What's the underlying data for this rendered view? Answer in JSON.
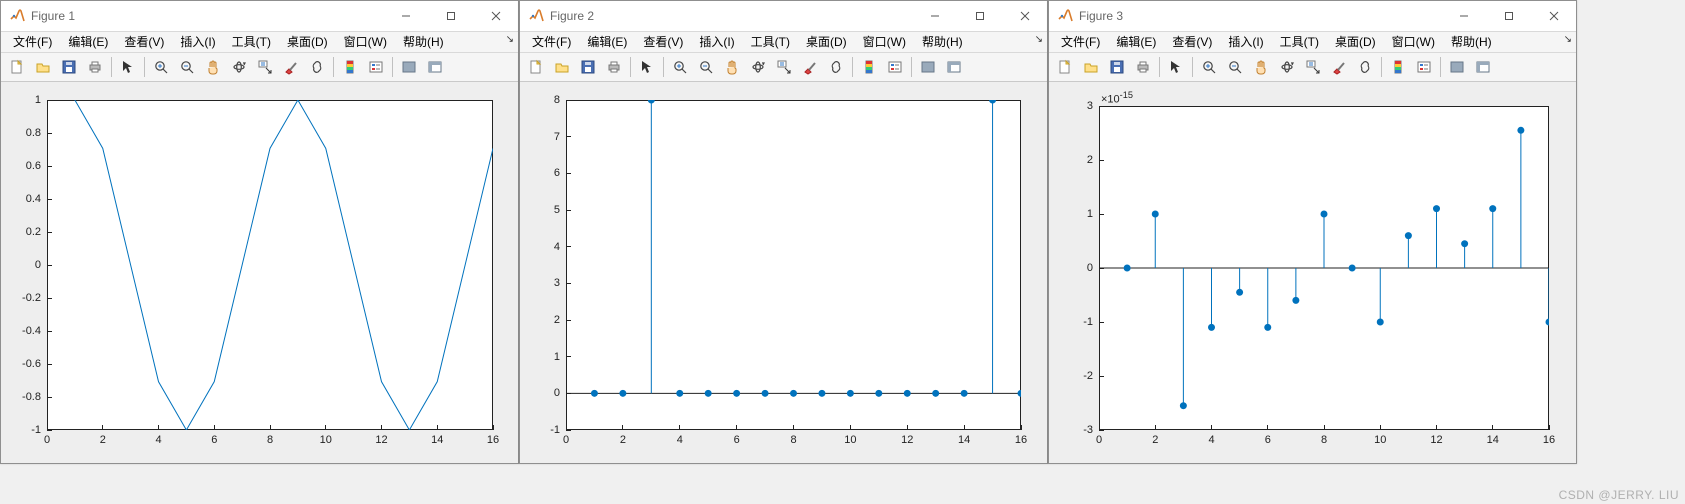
{
  "watermark": "CSDN @JERRY. LIU",
  "menus": [
    "文件(F)",
    "编辑(E)",
    "查看(V)",
    "插入(I)",
    "工具(T)",
    "桌面(D)",
    "窗口(W)",
    "帮助(H)"
  ],
  "toolbar_icons": [
    {
      "name": "new-figure-icon",
      "kind": "new"
    },
    {
      "name": "open-icon",
      "kind": "open"
    },
    {
      "name": "save-icon",
      "kind": "save"
    },
    {
      "name": "print-icon",
      "kind": "print"
    },
    {
      "sep": true
    },
    {
      "name": "edit-plot-icon",
      "kind": "arrow"
    },
    {
      "sep": true
    },
    {
      "name": "zoom-in-icon",
      "kind": "zoomin"
    },
    {
      "name": "zoom-out-icon",
      "kind": "zoomout"
    },
    {
      "name": "pan-icon",
      "kind": "hand"
    },
    {
      "name": "rotate-3d-icon",
      "kind": "rotate"
    },
    {
      "name": "data-cursor-icon",
      "kind": "datacursor"
    },
    {
      "name": "brush-icon",
      "kind": "brush"
    },
    {
      "name": "link-plot-icon",
      "kind": "link"
    },
    {
      "sep": true
    },
    {
      "name": "insert-colorbar-icon",
      "kind": "colorbar"
    },
    {
      "name": "insert-legend-icon",
      "kind": "legend"
    },
    {
      "sep": true
    },
    {
      "name": "hide-plot-tools-icon",
      "kind": "hidetools"
    },
    {
      "name": "show-plot-tools-icon",
      "kind": "showtools"
    }
  ],
  "windows": [
    {
      "title": "Figure 1"
    },
    {
      "title": "Figure 2"
    },
    {
      "title": "Figure 3"
    }
  ],
  "colors": {
    "line": "#0072BD",
    "marker": "#0072BD"
  },
  "chart_data": [
    {
      "type": "line",
      "x": [
        1,
        2,
        3,
        4,
        5,
        6,
        7,
        8,
        9,
        10,
        11,
        12,
        13,
        14,
        15,
        16
      ],
      "y": [
        1,
        0.7071,
        0,
        -0.7071,
        -1,
        -0.7071,
        0,
        0.7071,
        1,
        0.7071,
        0,
        -0.7071,
        -1,
        -0.7071,
        0,
        0.7071
      ],
      "xlim": [
        0,
        16
      ],
      "ylim": [
        -1,
        1
      ],
      "xticks": [
        0,
        2,
        4,
        6,
        8,
        10,
        12,
        14,
        16
      ],
      "yticks": [
        -1,
        -0.8,
        -0.6,
        -0.4,
        -0.2,
        0,
        0.2,
        0.4,
        0.6,
        0.8,
        1
      ]
    },
    {
      "type": "stem",
      "x": [
        1,
        2,
        3,
        4,
        5,
        6,
        7,
        8,
        9,
        10,
        11,
        12,
        13,
        14,
        15,
        16
      ],
      "y": [
        0,
        0,
        8,
        0,
        0,
        0,
        0,
        0,
        0,
        0,
        0,
        0,
        0,
        0,
        8,
        0
      ],
      "xlim": [
        0,
        16
      ],
      "ylim": [
        -1,
        8
      ],
      "xticks": [
        0,
        2,
        4,
        6,
        8,
        10,
        12,
        14,
        16
      ],
      "yticks": [
        -1,
        0,
        1,
        2,
        3,
        4,
        5,
        6,
        7,
        8
      ],
      "baseline": 0
    },
    {
      "type": "stem",
      "x": [
        1,
        2,
        3,
        4,
        5,
        6,
        7,
        8,
        9,
        10,
        11,
        12,
        13,
        14,
        15,
        16
      ],
      "y": [
        0,
        1,
        -2.55,
        -1.1,
        -0.45,
        -1.1,
        -0.6,
        1,
        0,
        -1,
        0.6,
        1.1,
        0.45,
        1.1,
        2.55,
        -1
      ],
      "xlim": [
        0,
        16
      ],
      "ylim": [
        -3,
        3
      ],
      "xticks": [
        0,
        2,
        4,
        6,
        8,
        10,
        12,
        14,
        16
      ],
      "yticks": [
        -3,
        -2,
        -1,
        0,
        1,
        2,
        3
      ],
      "exponent": "×10^{-15}",
      "baseline": 0
    }
  ]
}
